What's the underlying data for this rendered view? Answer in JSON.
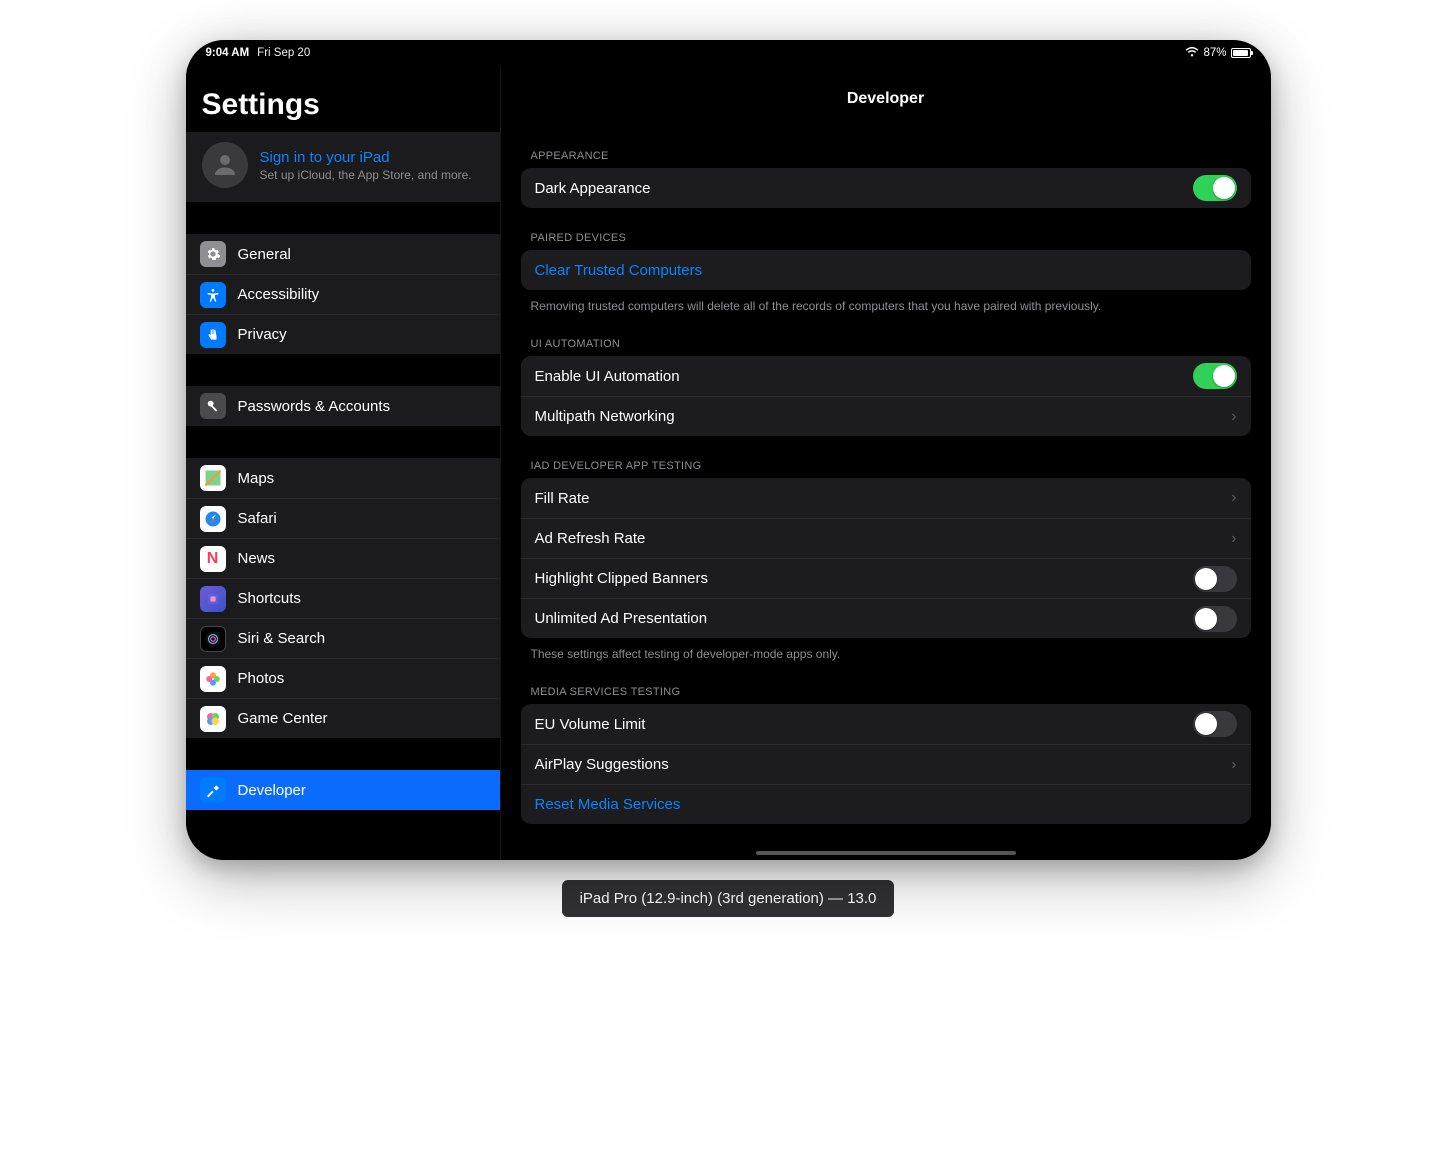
{
  "status": {
    "time": "9:04 AM",
    "date": "Fri Sep 20",
    "battery_pct": "87%"
  },
  "sidebar": {
    "title": "Settings",
    "signin_link": "Sign in to your iPad",
    "signin_sub": "Set up iCloud, the App Store, and more.",
    "groups": [
      [
        {
          "icon": "gear-icon",
          "label": "General"
        },
        {
          "icon": "accessibility-icon",
          "label": "Accessibility"
        },
        {
          "icon": "hand-icon",
          "label": "Privacy"
        }
      ],
      [
        {
          "icon": "key-icon",
          "label": "Passwords & Accounts"
        }
      ],
      [
        {
          "icon": "maps-icon",
          "label": "Maps"
        },
        {
          "icon": "safari-icon",
          "label": "Safari"
        },
        {
          "icon": "news-icon",
          "label": "News"
        },
        {
          "icon": "shortcuts-icon",
          "label": "Shortcuts"
        },
        {
          "icon": "siri-icon",
          "label": "Siri & Search"
        },
        {
          "icon": "photos-icon",
          "label": "Photos"
        },
        {
          "icon": "gamecenter-icon",
          "label": "Game Center"
        }
      ],
      [
        {
          "icon": "hammer-icon",
          "label": "Developer",
          "selected": true
        }
      ]
    ]
  },
  "detail": {
    "title": "Developer",
    "sections": [
      {
        "header": "APPEARANCE",
        "rows": [
          {
            "label": "Dark Appearance",
            "type": "switch",
            "on": true
          }
        ]
      },
      {
        "header": "PAIRED DEVICES",
        "rows": [
          {
            "label": "Clear Trusted Computers",
            "type": "link"
          }
        ],
        "footer": "Removing trusted computers will delete all of the records of computers that you have paired with previously."
      },
      {
        "header": "UI AUTOMATION",
        "rows": [
          {
            "label": "Enable UI Automation",
            "type": "switch",
            "on": true
          },
          {
            "label": "Multipath Networking",
            "type": "nav"
          }
        ]
      },
      {
        "header": "IAD DEVELOPER APP TESTING",
        "rows": [
          {
            "label": "Fill Rate",
            "type": "nav"
          },
          {
            "label": "Ad Refresh Rate",
            "type": "nav"
          },
          {
            "label": "Highlight Clipped Banners",
            "type": "switch",
            "on": false
          },
          {
            "label": "Unlimited Ad Presentation",
            "type": "switch",
            "on": false
          }
        ],
        "footer": "These settings affect testing of developer-mode apps only."
      },
      {
        "header": "MEDIA SERVICES TESTING",
        "rows": [
          {
            "label": "EU Volume Limit",
            "type": "switch",
            "on": false
          },
          {
            "label": "AirPlay Suggestions",
            "type": "nav"
          },
          {
            "label": "Reset Media Services",
            "type": "link"
          }
        ]
      }
    ]
  },
  "caption": "iPad Pro (12.9-inch) (3rd generation) — 13.0"
}
